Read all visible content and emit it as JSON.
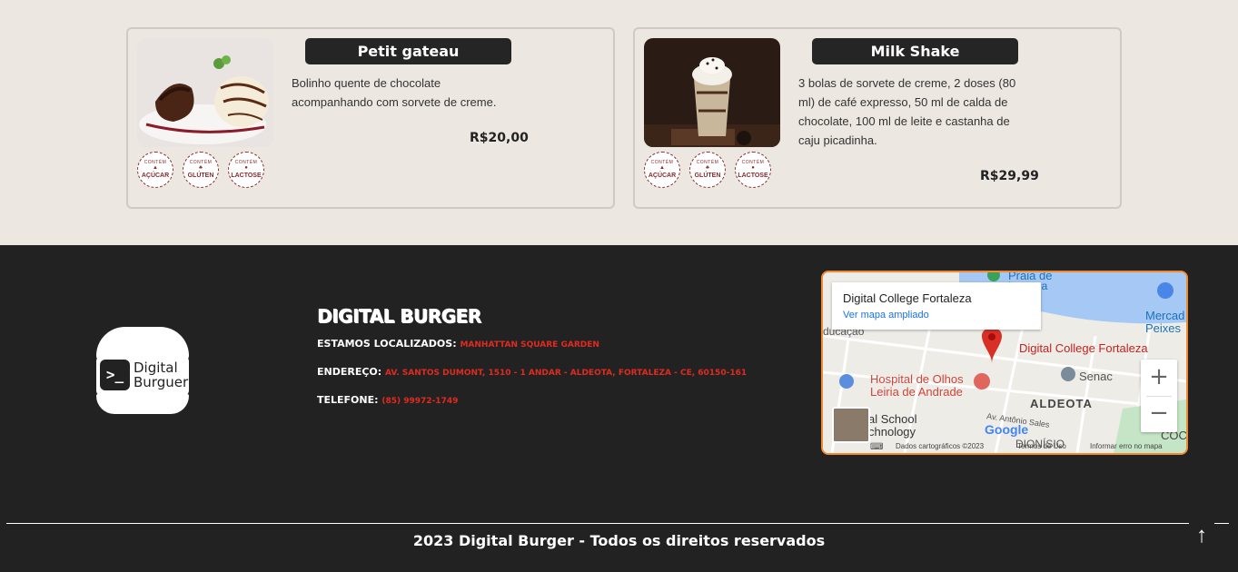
{
  "menu": {
    "items": [
      {
        "title": "Petit gateau",
        "description": "Bolinho quente de chocolate acompanhando com sorvete de creme.",
        "price": "R$20,00",
        "badges": [
          "AÇÚCAR",
          "GLÚTEN",
          "LACTOSE"
        ]
      },
      {
        "title": "Milk Shake",
        "description": "3 bolas de sorvete de creme, 2 doses (80 ml) de café expresso, 50 ml de calda de chocolate, 100 ml de leite e castanha de caju picadinha.",
        "price": "R$29,99",
        "badges": [
          "AÇÚCAR",
          "GLÚTEN",
          "LACTOSE"
        ]
      }
    ],
    "badge_top_text": "CONTÉM"
  },
  "footer": {
    "logo": {
      "line1": "Digital",
      "line2": "Burguer",
      "prompt": ">_"
    },
    "brand": "DIGITAL BURGER",
    "location_label": "ESTAMOS LOCALIZADOS:",
    "location_value": "MANHATTAN SQUARE GARDEN",
    "address_label": "ENDEREÇO:",
    "address_value": "AV. SANTOS DUMONT, 1510 - 1 ANDAR - ALDEOTA, FORTALEZA - CE, 60150-161",
    "phone_label": "TELEFONE:",
    "phone_value": "(85) 99972-1749",
    "copyright": "2023 Digital Burger - Todos os direitos reservados",
    "back_to_top_icon": "arrow-up-icon"
  },
  "map": {
    "popup_title": "Digital College Fortaleza",
    "popup_link": "Ver mapa ampliado",
    "pin_label": "Digital College Fortaleza",
    "labels": {
      "praia": "Praia de",
      "praia2": "Iracema",
      "mercado": "Mercad",
      "peixes": "Peixes",
      "educacao": "ducação",
      "hospital1": "Hospital de Olhos",
      "hospital2": "Leiria de Andrade",
      "senac": "Senac",
      "aldeota": "ALDEOTA",
      "school1": "al School",
      "school2": "chnology",
      "antonio": "Av. Antônio Sales",
      "dionisio": "DIONÍSIO",
      "coco": "COCÓ",
      "google": "Google"
    },
    "attribution": {
      "data": "Dados cartográficos ©2023",
      "terms": "Termos de Uso",
      "report": "Informar erro no mapa"
    },
    "zoom_in": "+",
    "zoom_out": "−"
  },
  "colors": {
    "accent_red": "#e02b20",
    "map_border": "#f08a33",
    "footer_bg": "#232222",
    "page_bg": "#ece7e1"
  }
}
